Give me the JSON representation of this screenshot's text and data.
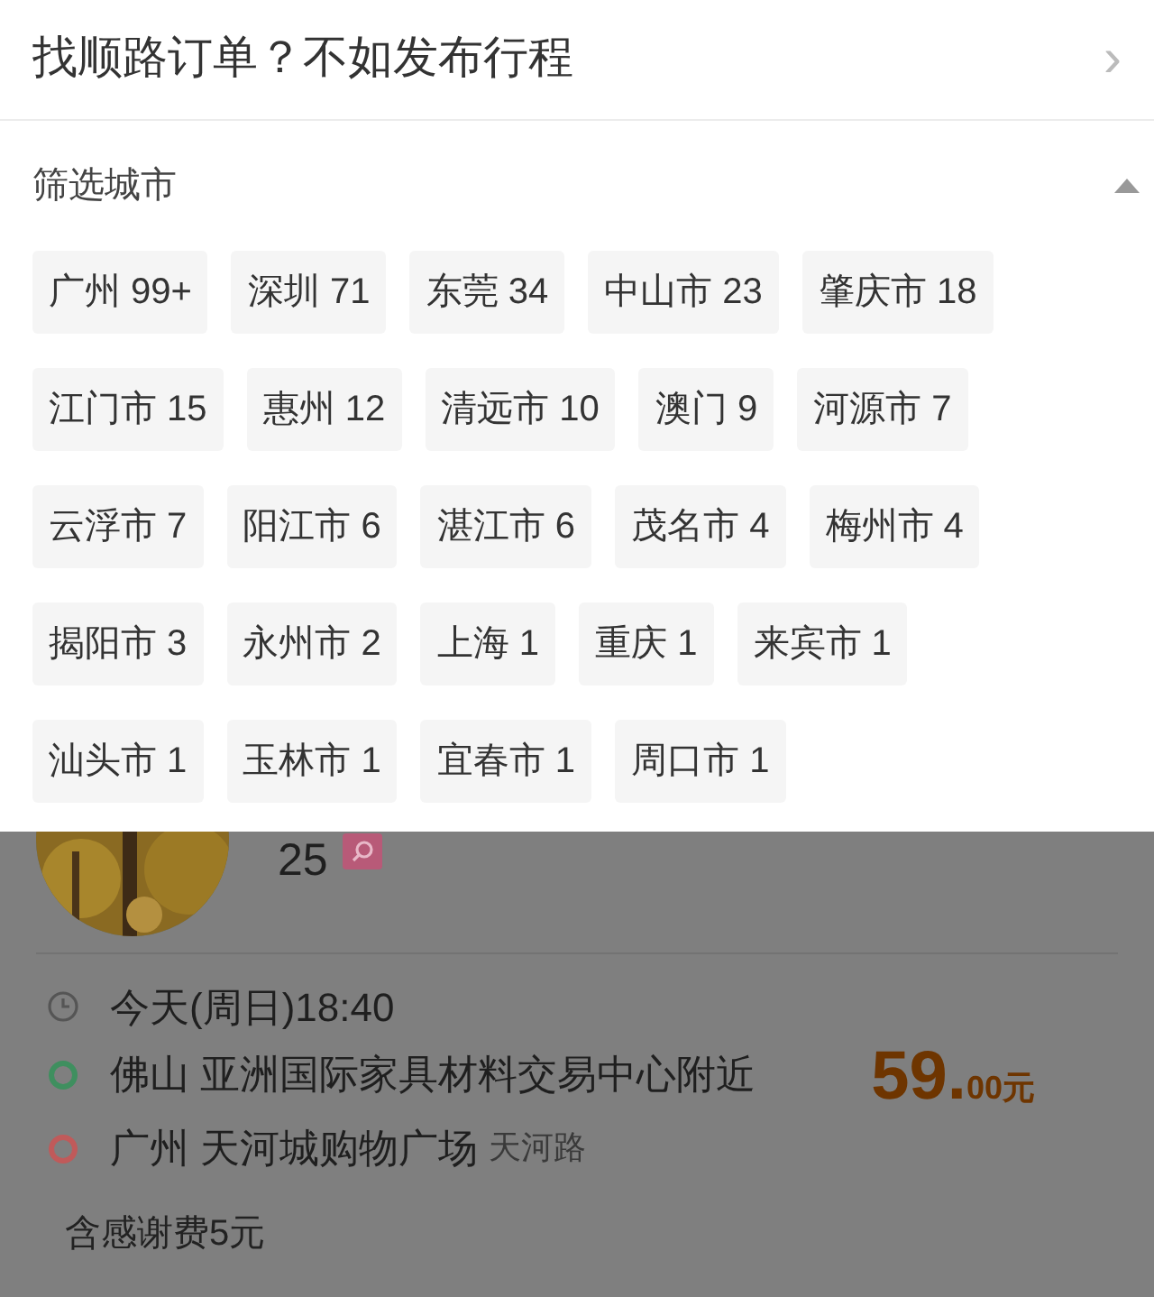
{
  "header": {
    "title": "找顺路订单？不如发布行程",
    "chevron": "›"
  },
  "filter": {
    "title": "筛选城市",
    "expanded": true,
    "rows": [
      [
        "广州 99+",
        "深圳 71",
        "东莞 34",
        "中山市 23",
        "肇庆市 18"
      ],
      [
        "江门市 15",
        "惠州 12",
        "清远市 10",
        "澳门 9",
        "河源市 7"
      ],
      [
        "云浮市 7",
        "阳江市 6",
        "湛江市 6",
        "茂名市 4",
        "梅州市 4"
      ],
      [
        "揭阳市 3",
        "永州市 2",
        "上海 1",
        "重庆 1",
        "来宾市 1"
      ],
      [
        "汕头市 1",
        "玉林市 1",
        "宜春市 1",
        "周口市 1"
      ]
    ]
  },
  "order": {
    "count": "25",
    "time": "今天(周日)18:40",
    "stops": [
      {
        "color": "#3f8f5f",
        "city": "佛山",
        "place": "亚洲国际家具材料交易中心附近"
      },
      {
        "color": "#c05a5a",
        "city": "广州",
        "place": "天河城购物广场",
        "note": "天河路"
      }
    ],
    "price_main": "59.",
    "price_cents": "00元",
    "fee": "含感谢费5元"
  }
}
